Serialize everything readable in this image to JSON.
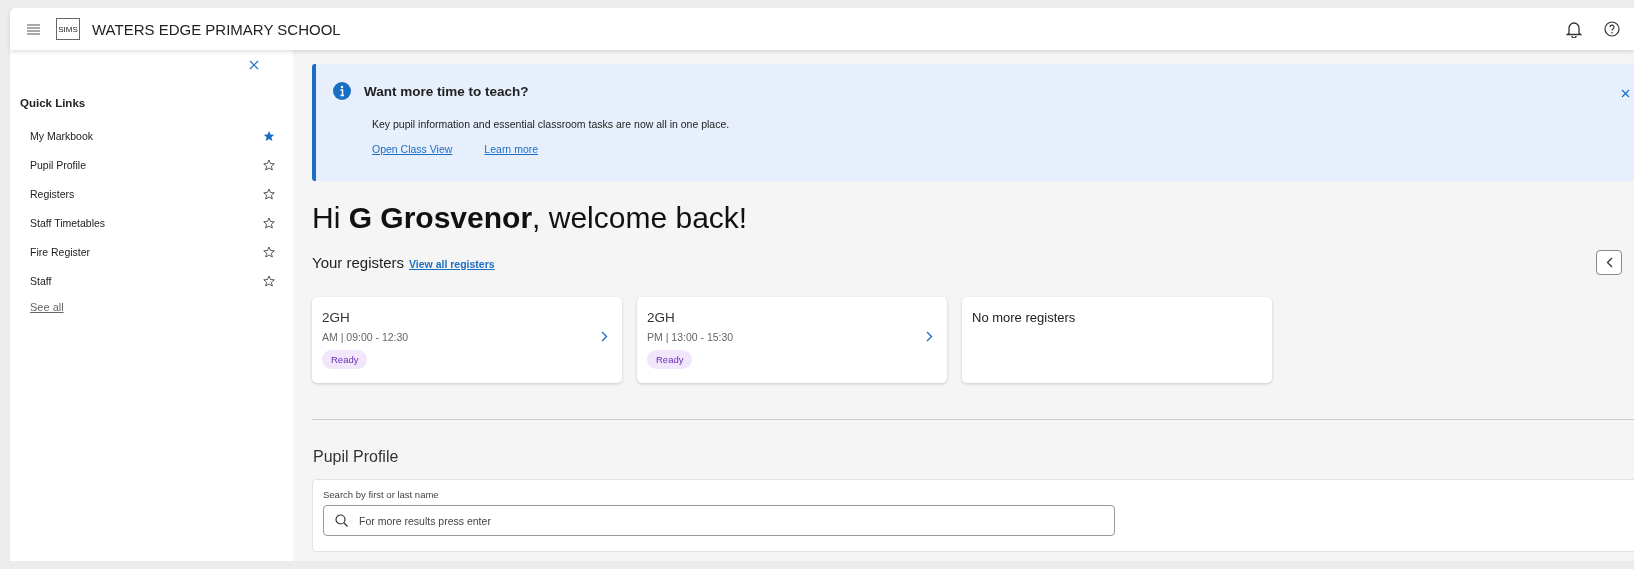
{
  "header": {
    "logo_text": "SIMS",
    "school_name": "WATERS EDGE PRIMARY SCHOOL"
  },
  "sidebar": {
    "title": "Quick Links",
    "items": [
      {
        "label": "My Markbook",
        "starred": true
      },
      {
        "label": "Pupil Profile",
        "starred": false
      },
      {
        "label": "Registers",
        "starred": false
      },
      {
        "label": "Staff Timetables",
        "starred": false
      },
      {
        "label": "Fire Register",
        "starred": false
      },
      {
        "label": "Staff",
        "starred": false
      }
    ],
    "see_all": "See all"
  },
  "banner": {
    "title": "Want more time to teach?",
    "text": "Key pupil information and essential classroom tasks are now all in one place.",
    "links": [
      "Open Class View",
      "Learn more"
    ]
  },
  "greeting": "Hi **G Grosvenor**, welcome back!",
  "registers": {
    "title": "Your registers",
    "link": "View all registers",
    "cards": [
      {
        "kind": "register",
        "name": "2GH",
        "time": "AM | 09:00 - 12:30",
        "status": "Ready"
      },
      {
        "kind": "register",
        "name": "2GH",
        "time": "PM | 13:00 - 15:30",
        "status": "Ready"
      },
      {
        "kind": "empty",
        "message": "No more registers"
      }
    ]
  },
  "pupil_profile": {
    "title": "Pupil Profile",
    "search_label": "Search by first or last name",
    "placeholder": "For more results press enter"
  }
}
